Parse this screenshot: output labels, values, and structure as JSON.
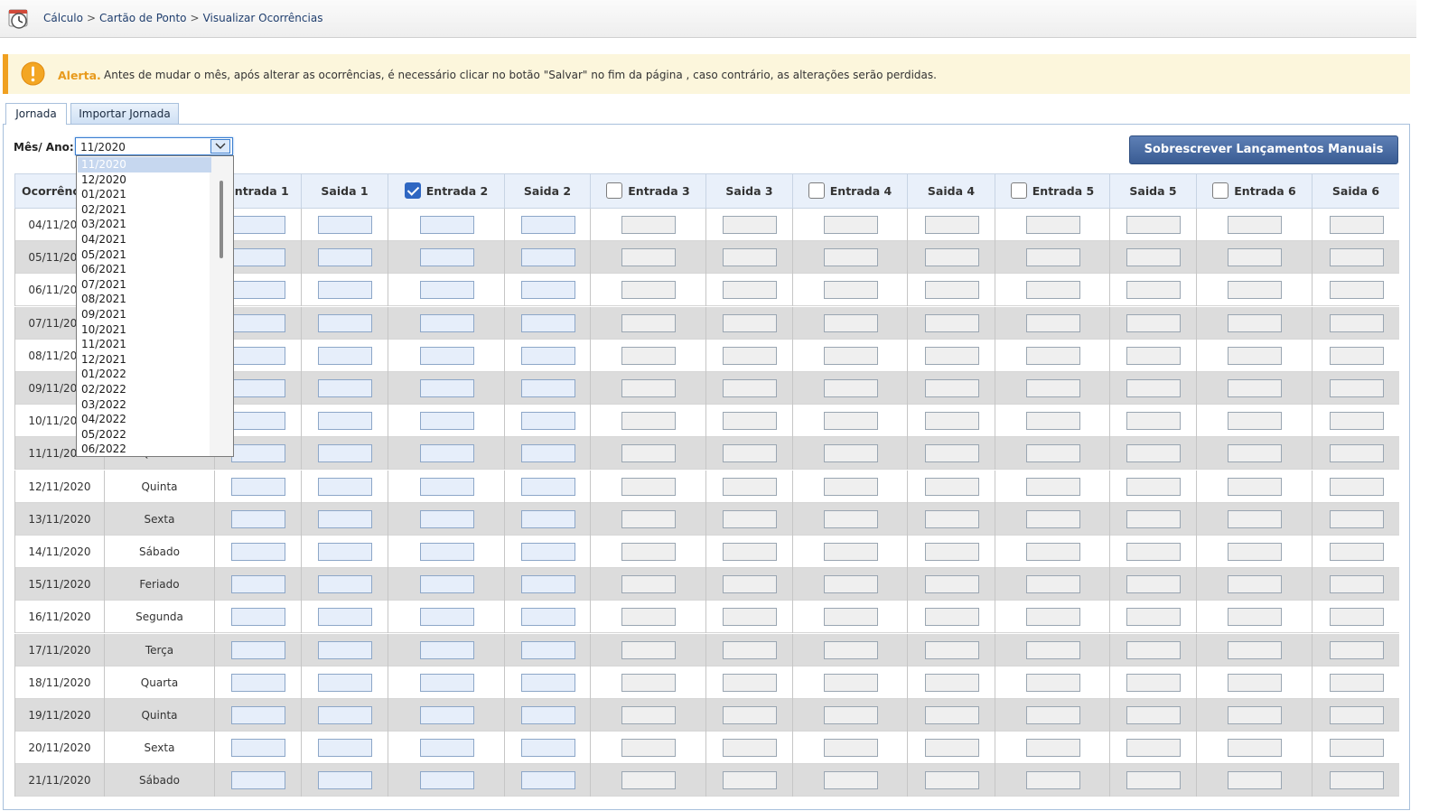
{
  "breadcrumb": [
    "Cálculo",
    "Cartão de Ponto",
    "Visualizar Ocorrências"
  ],
  "breadcrumb_separator": ">",
  "alert": {
    "title": "Alerta.",
    "message": "Antes de mudar o mês, após alterar as ocorrências, é necessário clicar no botão \"Salvar\" no fim da página , caso contrário, as alterações serão perdidas."
  },
  "tabs": [
    {
      "label": "Jornada",
      "active": true
    },
    {
      "label": "Importar Jornada",
      "active": false
    }
  ],
  "mes_ano": {
    "label": "Mês/ Ano:",
    "selected": "11/2020",
    "options": [
      "11/2020",
      "12/2020",
      "01/2021",
      "02/2021",
      "03/2021",
      "04/2021",
      "05/2021",
      "06/2021",
      "07/2021",
      "08/2021",
      "09/2021",
      "10/2021",
      "11/2021",
      "12/2021",
      "01/2022",
      "02/2022",
      "03/2022",
      "04/2022",
      "05/2022",
      "06/2022"
    ]
  },
  "overwrite_button": "Sobrescrever Lançamentos Manuais",
  "table": {
    "headers": [
      {
        "label": "Ocorrências",
        "checkbox": null
      },
      {
        "label": "",
        "checkbox": null
      },
      {
        "label": "Entrada 1",
        "checkbox": null
      },
      {
        "label": "Saida 1",
        "checkbox": null
      },
      {
        "label": "Entrada 2",
        "checkbox": "checked"
      },
      {
        "label": "Saida 2",
        "checkbox": null
      },
      {
        "label": "Entrada 3",
        "checkbox": "unchecked"
      },
      {
        "label": "Saida 3",
        "checkbox": null
      },
      {
        "label": "Entrada 4",
        "checkbox": "unchecked"
      },
      {
        "label": "Saida 4",
        "checkbox": null
      },
      {
        "label": "Entrada 5",
        "checkbox": "unchecked"
      },
      {
        "label": "Saida 5",
        "checkbox": null
      },
      {
        "label": "Entrada 6",
        "checkbox": "unchecked"
      },
      {
        "label": "Saida 6",
        "checkbox": null
      }
    ],
    "rows": [
      {
        "date": "04/11/2020",
        "day": ""
      },
      {
        "date": "05/11/2020",
        "day": ""
      },
      {
        "date": "06/11/2020",
        "day": ""
      },
      {
        "date": "07/11/2020",
        "day": ""
      },
      {
        "date": "08/11/2020",
        "day": ""
      },
      {
        "date": "09/11/2020",
        "day": ""
      },
      {
        "date": "10/11/2020",
        "day": ""
      },
      {
        "date": "11/11/2020",
        "day": "Quarta"
      },
      {
        "date": "12/11/2020",
        "day": "Quinta"
      },
      {
        "date": "13/11/2020",
        "day": "Sexta"
      },
      {
        "date": "14/11/2020",
        "day": "Sábado"
      },
      {
        "date": "15/11/2020",
        "day": "Feriado"
      },
      {
        "date": "16/11/2020",
        "day": "Segunda"
      },
      {
        "date": "17/11/2020",
        "day": "Terça"
      },
      {
        "date": "18/11/2020",
        "day": "Quarta"
      },
      {
        "date": "19/11/2020",
        "day": "Quinta"
      },
      {
        "date": "20/11/2020",
        "day": "Sexta"
      },
      {
        "date": "21/11/2020",
        "day": "Sábado"
      }
    ]
  },
  "colors": {
    "alert_accent": "#f0a020",
    "button_bg": "#3a5c93",
    "header_bg": "#e9f0fa",
    "checkbox_checked": "#2f67c2"
  }
}
